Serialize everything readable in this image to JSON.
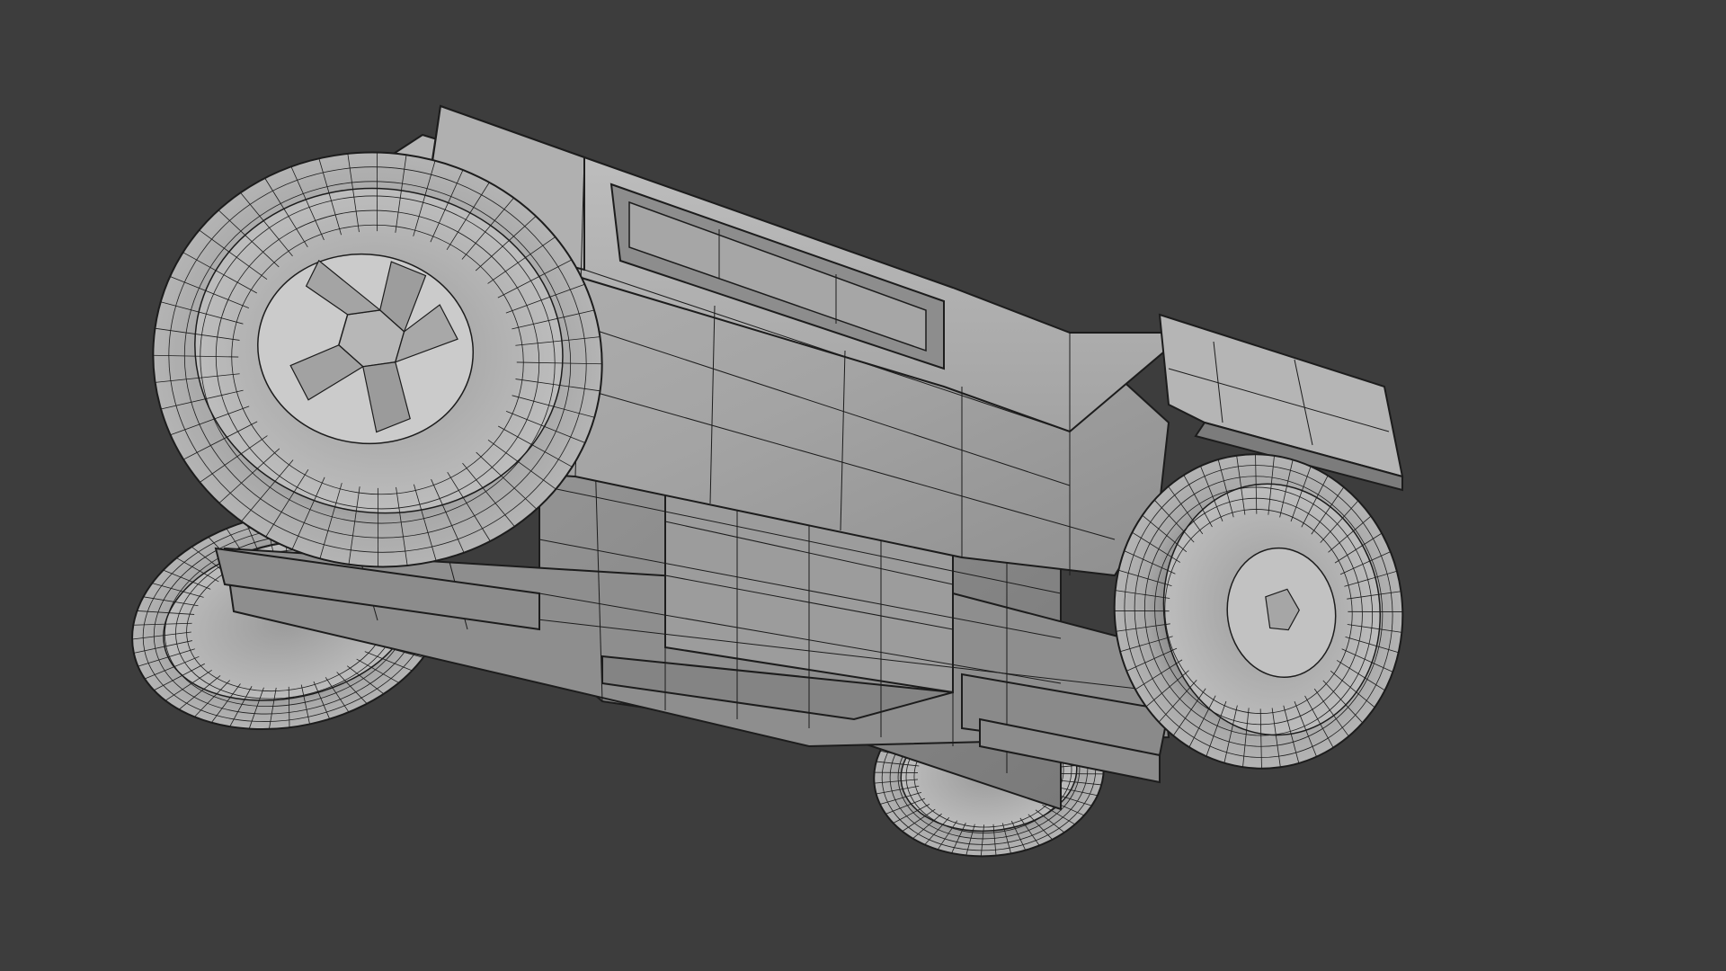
{
  "viewport": {
    "background": "#3d3d3d",
    "shading": "solid",
    "overlay": "wireframe"
  },
  "model": {
    "mesh_color": "#a9a9a9",
    "edge_color": "#1c1c1c",
    "parts": [
      "body-main",
      "body-roof",
      "body-windshield-recess",
      "rear-spoiler",
      "chassis-block",
      "axle",
      "wheel-front-left",
      "wheel-rear-left",
      "wheel-front-right",
      "wheel-rear-right"
    ]
  }
}
